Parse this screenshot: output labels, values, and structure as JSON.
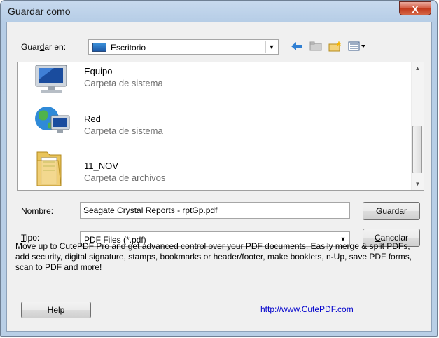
{
  "window": {
    "title": "Guardar como",
    "close_label": "X"
  },
  "save_in": {
    "label_prefix": "Guar",
    "label_key": "d",
    "label_suffix": "ar en:",
    "value": "Escritorio"
  },
  "toolbar": {
    "icons": [
      "back-arrow-icon",
      "up-folder-icon",
      "new-folder-icon",
      "view-menu-icon"
    ]
  },
  "files": [
    {
      "name": "Equipo",
      "type": "Carpeta de sistema",
      "icon": "computer-icon"
    },
    {
      "name": "Red",
      "type": "Carpeta de sistema",
      "icon": "network-globe-icon"
    },
    {
      "name": "11_NOV",
      "type": "Carpeta de archivos",
      "icon": "folder-icon"
    }
  ],
  "filename": {
    "label_prefix": "N",
    "label_key": "o",
    "label_suffix": "mbre:",
    "value": "Seagate Crystal Reports - rptGp.pdf"
  },
  "filetype": {
    "label_key": "T",
    "label_suffix": "ipo:",
    "value": "PDF Files (*.pdf)"
  },
  "buttons": {
    "save_key": "G",
    "save_rest": "uardar",
    "cancel_key": "C",
    "cancel_rest": "ancelar",
    "help": "Help"
  },
  "promo": {
    "text": "Move up to CutePDF Pro and get advanced control over your PDF documents. Easily merge & split PDFs, add security, digital signature, stamps, bookmarks or header/footer, make booklets, n-Up, save PDF forms, scan to PDF and more!",
    "link": "http://www.CutePDF.com"
  },
  "colors": {
    "titlebar": "#b9cfe6",
    "close": "#c23a1d",
    "link": "#0000cc",
    "secondary_text": "#6d6d6d"
  }
}
